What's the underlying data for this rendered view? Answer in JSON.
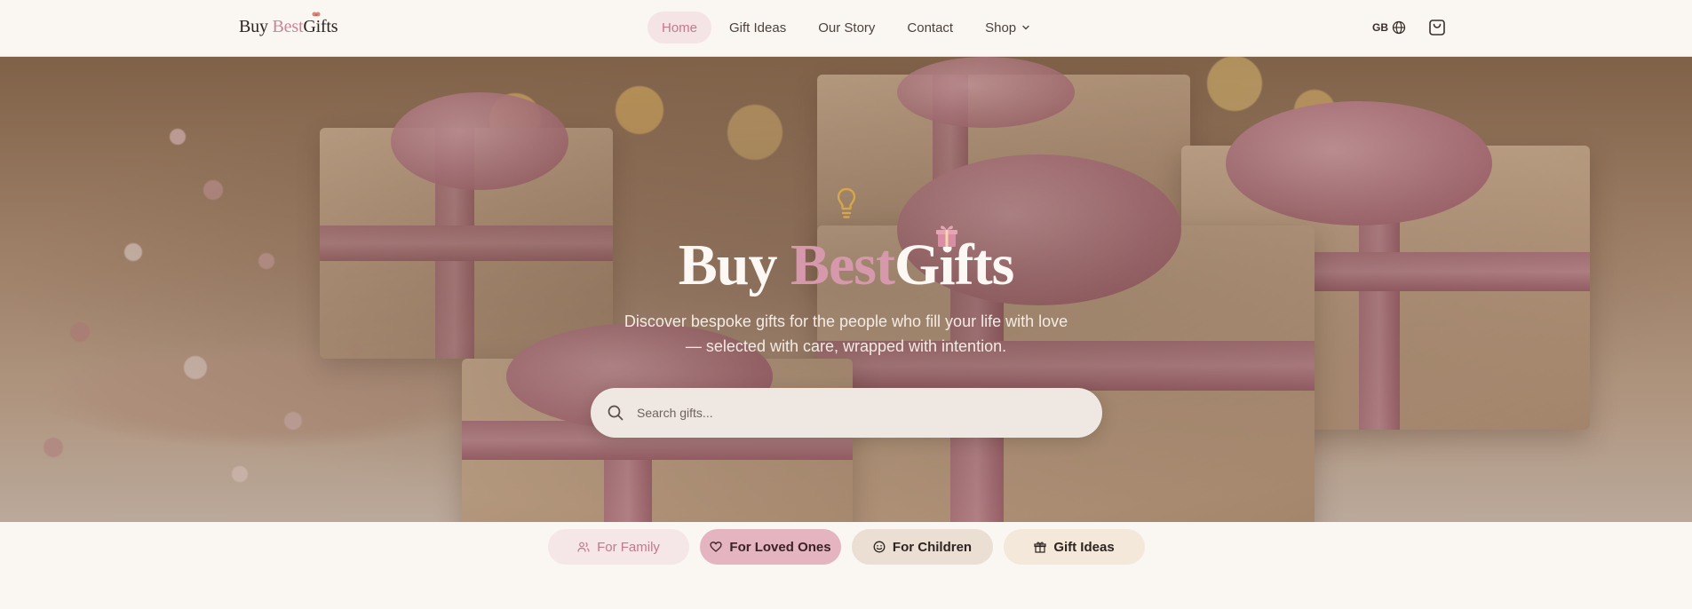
{
  "brand": {
    "part1": "Buy ",
    "part2": "Best",
    "part3": " G",
    "part4": "ifts",
    "accent": "#c9849a"
  },
  "nav": {
    "items": [
      {
        "label": "Home",
        "active": true
      },
      {
        "label": "Gift Ideas",
        "active": false
      },
      {
        "label": "Our Story",
        "active": false
      },
      {
        "label": "Contact",
        "active": false
      },
      {
        "label": "Shop",
        "active": false,
        "icon": "chevron-down-icon"
      }
    ]
  },
  "header_right": {
    "lang_code": "GB",
    "lang_icon": "globe-icon",
    "cart_icon": "shopping-bag-icon"
  },
  "hero": {
    "icon": "lightbulb-icon",
    "title_part1": "Buy ",
    "title_part2": "Best",
    "title_part3": " G",
    "title_part4": "ifts",
    "subtitle": "Discover bespoke gifts for the people who fill your life with love — selected with care, wrapped with intention.",
    "search_placeholder": "Search gifts..."
  },
  "categories": [
    {
      "label": "For Family",
      "icon": "users-icon",
      "active": true
    },
    {
      "label": "For Loved Ones",
      "icon": "heart-icon"
    },
    {
      "label": "For Children",
      "icon": "smile-icon"
    },
    {
      "label": "Gift Ideas",
      "icon": "gift-icon"
    }
  ]
}
